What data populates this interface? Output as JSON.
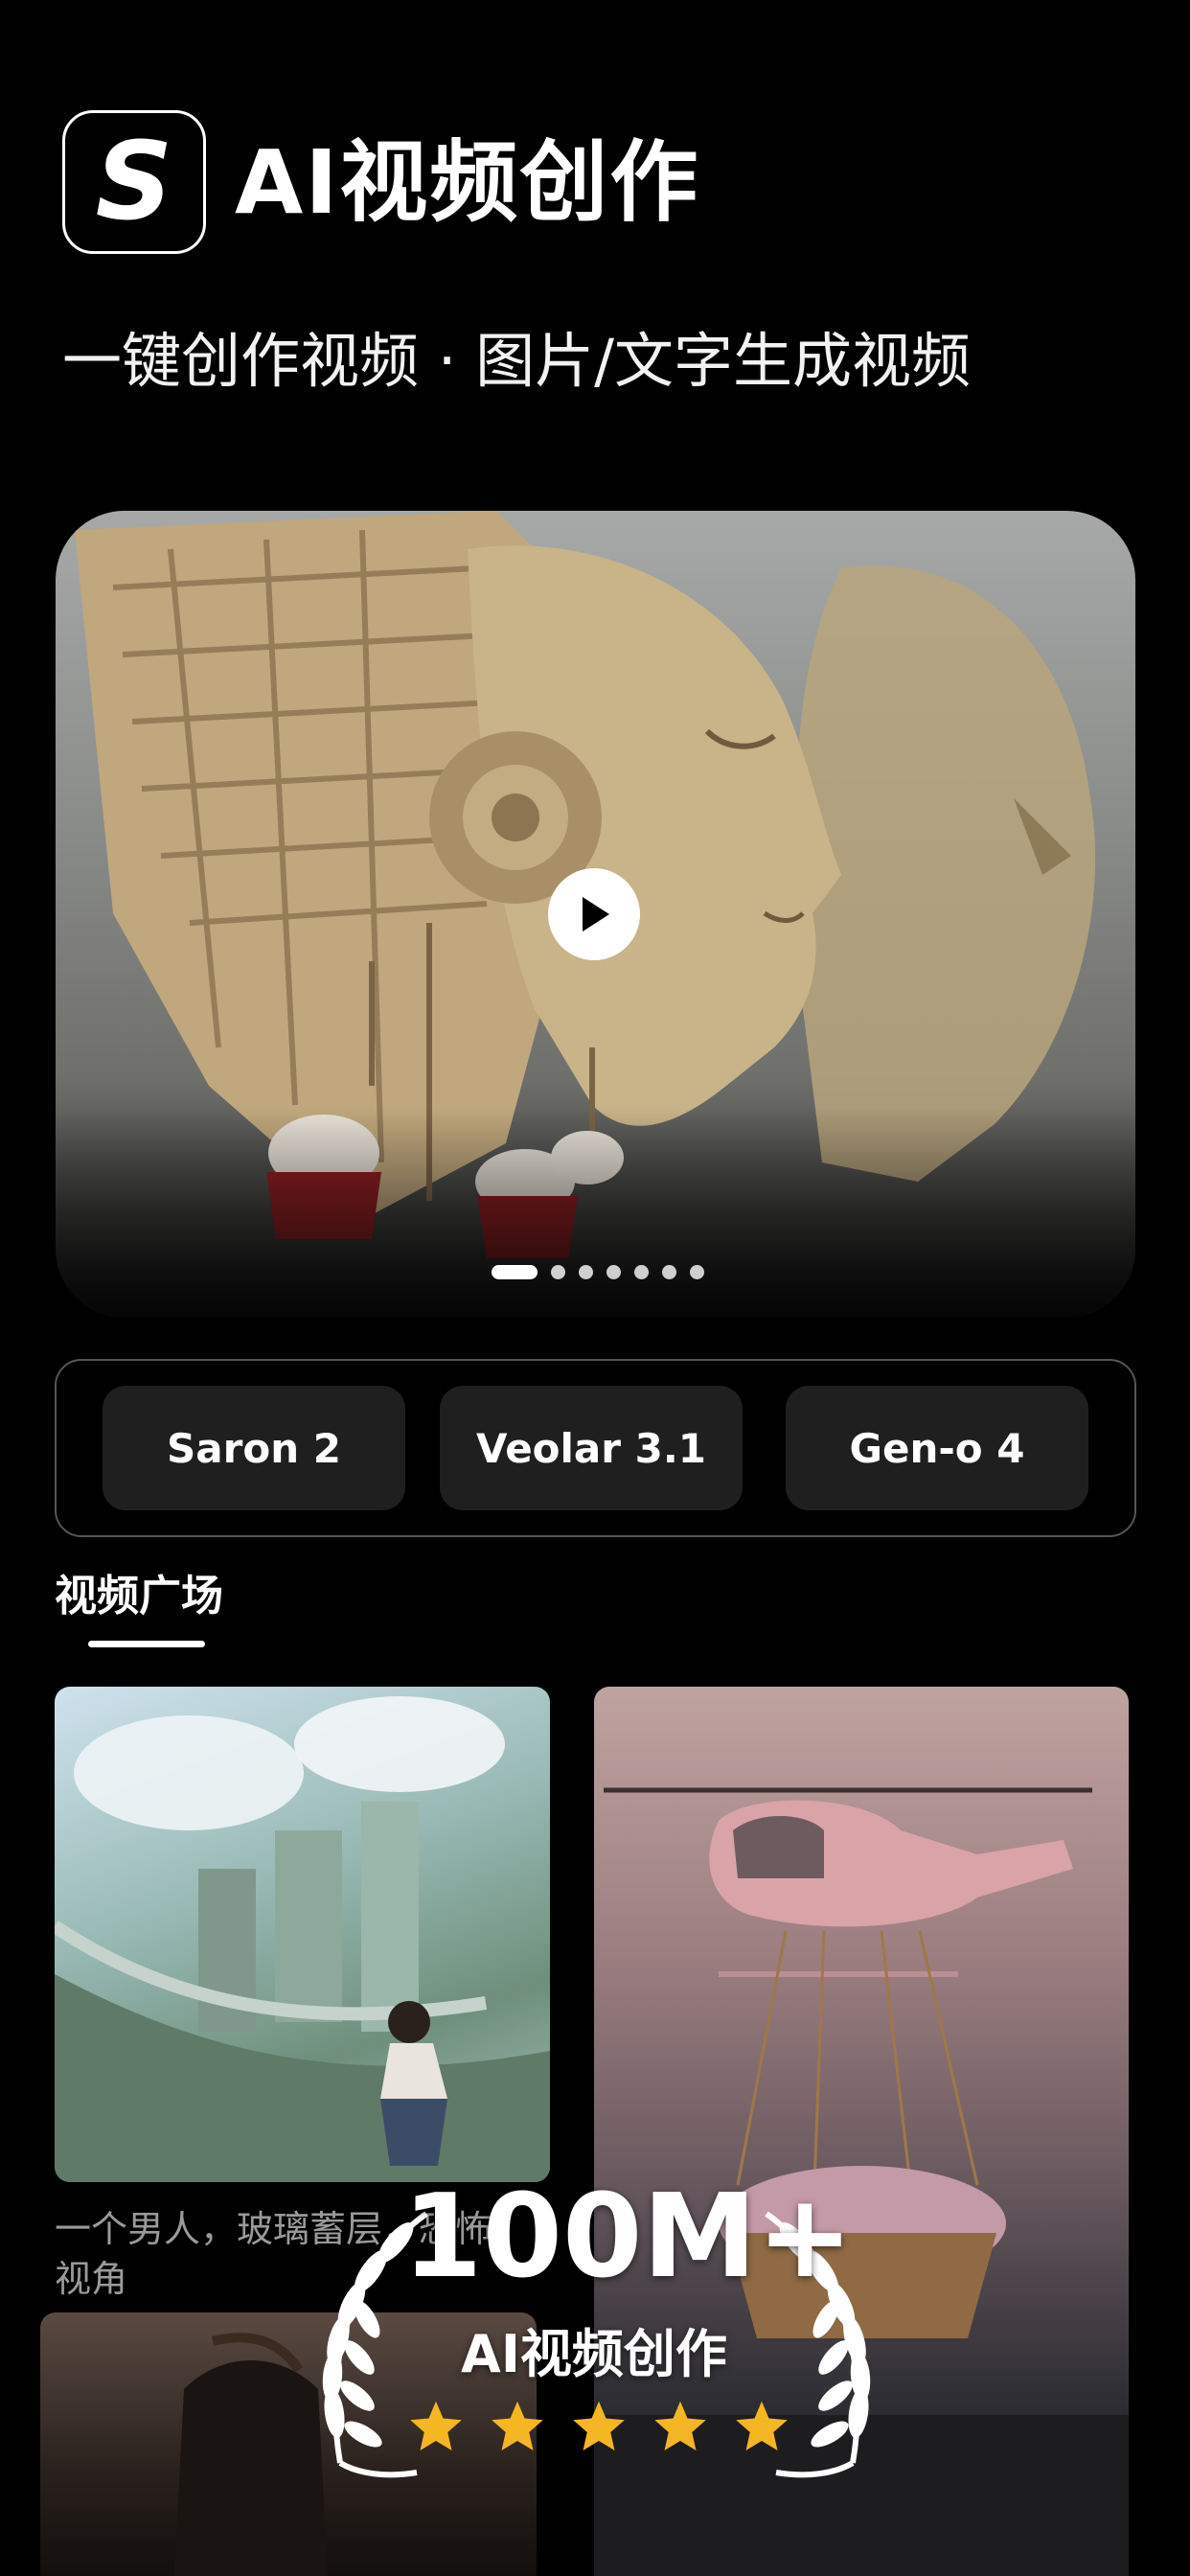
{
  "header": {
    "logo_letter": "S",
    "title": "AI视频创作",
    "subtitle": "一键创作视频 · 图片/文字生成视频"
  },
  "hero": {
    "play_icon": "play-icon",
    "carousel_pages": 7,
    "active_page": 1
  },
  "models": [
    {
      "label": "Saron 2"
    },
    {
      "label": "Veolar 3.1"
    },
    {
      "label": "Gen-o 4"
    }
  ],
  "plaza": {
    "title": "视频广场",
    "cards": [
      {
        "caption": "一个男人，玻璃蓄层，恐怖视角"
      }
    ]
  },
  "badge": {
    "count": "100M+",
    "label": "AI视频创作",
    "stars": 5,
    "laurel_icon": "laurel-wreath-icon",
    "star_color": "#F5B623"
  }
}
